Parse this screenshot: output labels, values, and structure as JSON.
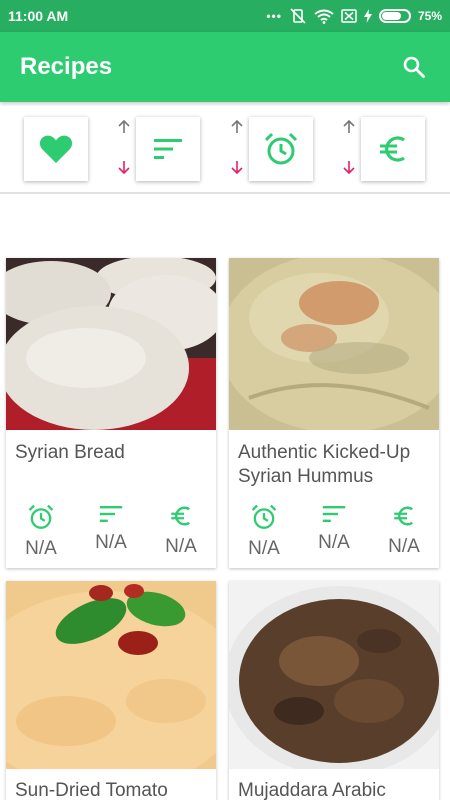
{
  "status_bar": {
    "time": "11:00 AM",
    "battery": "75%",
    "battery_level": 0.75
  },
  "app_bar": {
    "title": "Recipes"
  },
  "filters": [
    {
      "name": "favorites",
      "icon": "heart-icon"
    },
    {
      "name": "difficulty",
      "icon": "sort-lines-icon"
    },
    {
      "name": "time",
      "icon": "alarm-clock-icon"
    },
    {
      "name": "cost",
      "icon": "euro-icon"
    }
  ],
  "recipes": [
    {
      "title": "Syrian Bread",
      "time": "N/A",
      "difficulty": "N/A",
      "cost": "N/A"
    },
    {
      "title": "Authentic Kicked-Up Syrian Hummus",
      "time": "N/A",
      "difficulty": "N/A",
      "cost": "N/A"
    },
    {
      "title": "Sun-Dried Tomato",
      "time": "",
      "difficulty": "",
      "cost": ""
    },
    {
      "title": "Mujaddara Arabic",
      "time": "",
      "difficulty": "",
      "cost": ""
    }
  ],
  "colors": {
    "status_bar": "#27ae60",
    "app_bar": "#2ecc71",
    "accent": "#2ecc71",
    "sort_down": "#e91e63"
  }
}
